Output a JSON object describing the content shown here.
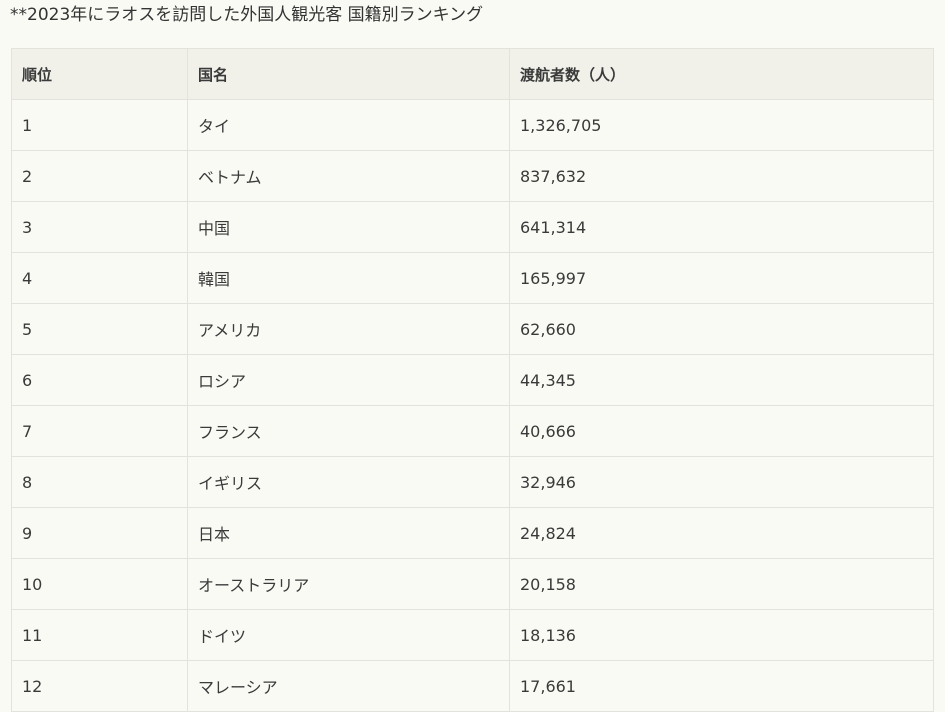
{
  "caption": "**2023年にラオスを訪問した外国人観光客 国籍別ランキング",
  "table": {
    "headers": [
      "順位",
      "国名",
      "渡航者数（人）"
    ],
    "rows": [
      {
        "rank": "1",
        "country": "タイ",
        "count": "1,326,705"
      },
      {
        "rank": "2",
        "country": "ベトナム",
        "count": "837,632"
      },
      {
        "rank": "3",
        "country": "中国",
        "count": "641,314"
      },
      {
        "rank": "4",
        "country": "韓国",
        "count": "165,997"
      },
      {
        "rank": "5",
        "country": "アメリカ",
        "count": "62,660"
      },
      {
        "rank": "6",
        "country": "ロシア",
        "count": "44,345"
      },
      {
        "rank": "7",
        "country": "フランス",
        "count": "40,666"
      },
      {
        "rank": "8",
        "country": "イギリス",
        "count": "32,946"
      },
      {
        "rank": "9",
        "country": "日本",
        "count": "24,824"
      },
      {
        "rank": "10",
        "country": "オーストラリア",
        "count": "20,158"
      },
      {
        "rank": "11",
        "country": "ドイツ",
        "count": "18,136"
      },
      {
        "rank": "12",
        "country": "マレーシア",
        "count": "17,661"
      }
    ]
  }
}
